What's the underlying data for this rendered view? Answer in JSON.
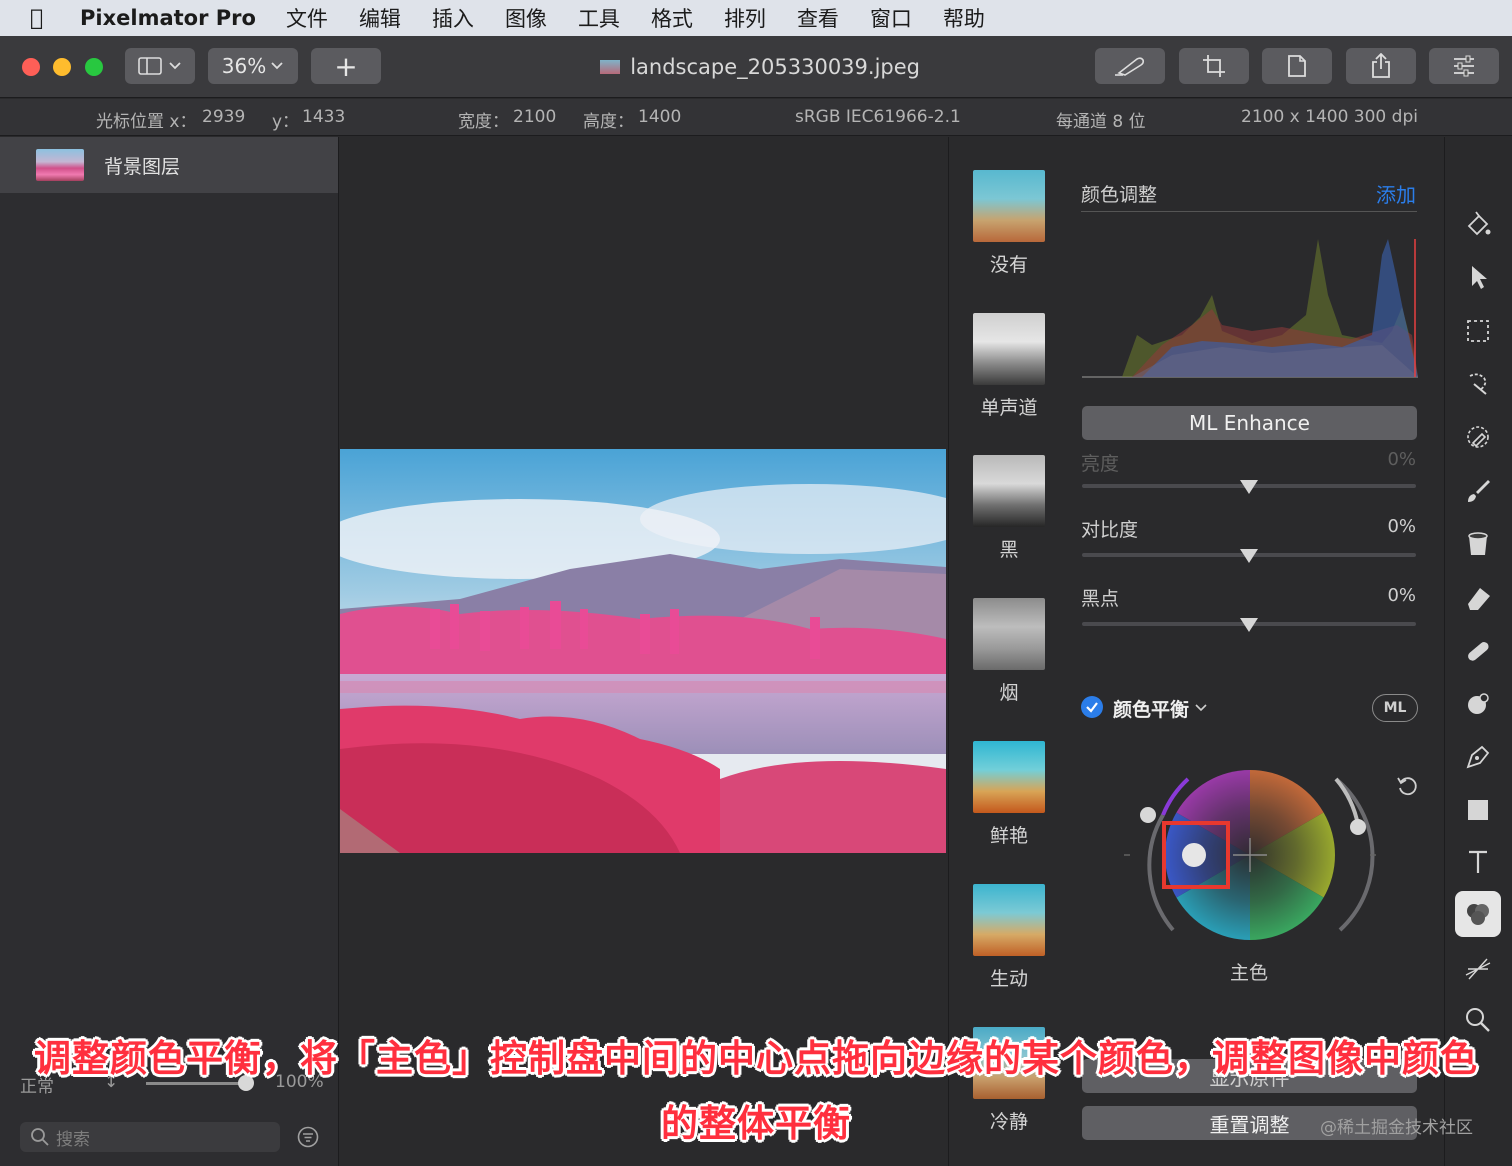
{
  "menubar": {
    "app_name": "Pixelmator Pro",
    "items": [
      "文件",
      "编辑",
      "插入",
      "图像",
      "工具",
      "格式",
      "排列",
      "查看",
      "窗口",
      "帮助"
    ]
  },
  "toolbar": {
    "zoom": "36%",
    "add_label": "+",
    "document_title": "landscape_205330039.jpeg"
  },
  "infobar": {
    "cursor_x_label": "光标位置 x：",
    "cursor_x": "2939",
    "cursor_y_label": "y：",
    "cursor_y": "1433",
    "width_label": "宽度：",
    "width": "2100",
    "height_label": "高度：",
    "height": "1400",
    "color_profile": "sRGB IEC61966-2.1",
    "bit_depth": "每通道 8 位",
    "resolution": "2100 x 1400 300 dpi"
  },
  "layers": {
    "items": [
      {
        "name": "背景图层"
      }
    ],
    "blend_mode": "正常",
    "opacity": "100%",
    "opacity_value": 1.0,
    "search_placeholder": "搜索"
  },
  "presets": [
    {
      "label": "没有",
      "style": "color"
    },
    {
      "label": "单声道",
      "style": "mono"
    },
    {
      "label": "黑",
      "style": "mono"
    },
    {
      "label": "烟",
      "style": "smoke"
    },
    {
      "label": "鲜艳",
      "style": "color"
    },
    {
      "label": "生动",
      "style": "color"
    },
    {
      "label": "冷静",
      "style": "color"
    }
  ],
  "adjustments": {
    "title": "颜色调整",
    "add_label": "添加",
    "ml_enhance": "ML Enhance",
    "brightness_label": "亮度",
    "brightness_value": "0%",
    "contrast_label": "对比度",
    "contrast_value": "0%",
    "blackpoint_label": "黑点",
    "blackpoint_value": "0%",
    "color_balance_label": "颜色平衡",
    "ml_badge": "ML",
    "wheel_label": "主色",
    "partial_button": "显示原件",
    "reset_label": "重置调整"
  },
  "colors": {
    "accent_blue": "#2b7de9",
    "highlight_red": "#e8382e",
    "caption_red": "#ff2f3e"
  },
  "caption": {
    "line1": "调整颜色平衡，将「主色」控制盘中间的中心点拖向边缘的某个颜色，调整图像中颜色",
    "line2": "的整体平衡"
  },
  "watermark": "@稀土掘金技术社区"
}
